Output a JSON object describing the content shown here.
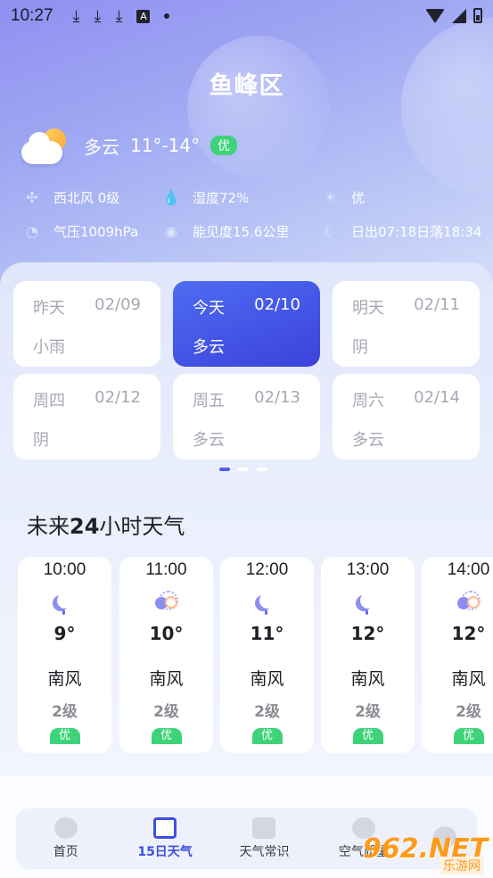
{
  "status_bar": {
    "time": "10:27",
    "icons": [
      "download-icon",
      "download-icon",
      "download-icon",
      "a-box-icon",
      "dot-icon",
      "wifi-icon",
      "signal-icon",
      "battery-icon"
    ],
    "a_box_glyph": "A"
  },
  "current": {
    "city": "鱼峰区",
    "condition_text": "多云",
    "temp_range": "11°-14°",
    "aqi": "优",
    "icon": "partly-cloudy-icon"
  },
  "details": [
    {
      "icon": "wind-icon",
      "text": "西北风 0级"
    },
    {
      "icon": "humidity-icon",
      "text": "湿度72%"
    },
    {
      "icon": "sun-icon",
      "text": "优"
    },
    {
      "icon": "pressure-icon",
      "text": "气压1009hPa"
    },
    {
      "icon": "eye-icon",
      "text": "能见度15.6公里"
    },
    {
      "icon": "moon-icon",
      "text": "日出07:18日落18:34"
    }
  ],
  "days": [
    {
      "day": "昨天",
      "date": "02/09",
      "cond": "小雨",
      "active": false
    },
    {
      "day": "今天",
      "date": "02/10",
      "cond": "多云",
      "active": true
    },
    {
      "day": "明天",
      "date": "02/11",
      "cond": "阴",
      "active": false
    },
    {
      "day": "周四",
      "date": "02/12",
      "cond": "阴",
      "active": false
    },
    {
      "day": "周五",
      "date": "02/13",
      "cond": "多云",
      "active": false
    },
    {
      "day": "周六",
      "date": "02/14",
      "cond": "多云",
      "active": false
    }
  ],
  "forecast_section": {
    "title_prefix": "未来",
    "title_num": "24",
    "title_suffix": "小时天气"
  },
  "hours": [
    {
      "time": "10:00",
      "icon": "moon-rain-icon",
      "temp": "9°",
      "wind": "南风",
      "level": "2级",
      "aqi": "优"
    },
    {
      "time": "11:00",
      "icon": "moon-cloud-icon",
      "temp": "10°",
      "wind": "南风",
      "level": "2级",
      "aqi": "优"
    },
    {
      "time": "12:00",
      "icon": "moon-rain-icon",
      "temp": "11°",
      "wind": "南风",
      "level": "2级",
      "aqi": "优"
    },
    {
      "time": "13:00",
      "icon": "moon-rain-icon",
      "temp": "12°",
      "wind": "南风",
      "level": "2级",
      "aqi": "优"
    },
    {
      "time": "14:00",
      "icon": "moon-cloud-icon",
      "temp": "12°",
      "wind": "南风",
      "level": "2级",
      "aqi": "优"
    }
  ],
  "nav": [
    {
      "label": "首页",
      "icon": "home-weather-icon",
      "active": false
    },
    {
      "label": "15日天气",
      "icon": "calendar-icon",
      "active": true
    },
    {
      "label": "天气常识",
      "icon": "book-icon",
      "active": false
    },
    {
      "label": "空气质量",
      "icon": "leaf-icon",
      "active": false
    }
  ],
  "watermark": {
    "brand": "962.NET",
    "sub": "乐游网"
  },
  "colors": {
    "accent": "#3c4fe0",
    "aqi_good": "#3ed37a",
    "header_top": "#8f8ff0"
  }
}
